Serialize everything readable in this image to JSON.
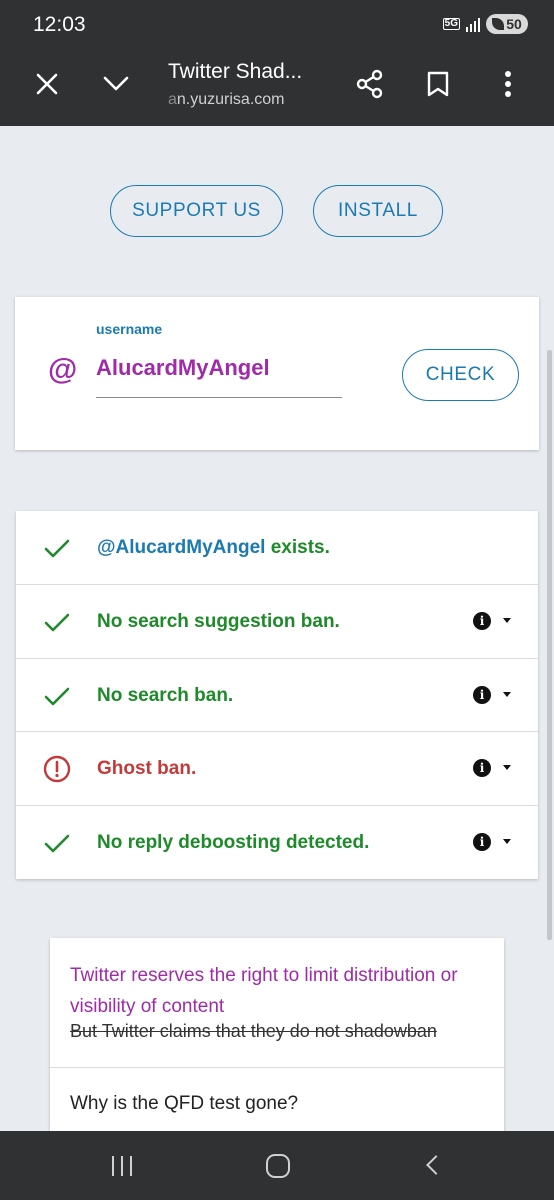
{
  "status": {
    "time": "12:03",
    "network": "5G",
    "battery": "50"
  },
  "browser": {
    "title": "Twitter Shad...",
    "url_prefix": "a",
    "url": "n.yuzurisa.com"
  },
  "buttons": {
    "support": "SUPPORT US",
    "install": "INSTALL"
  },
  "form": {
    "label": "username",
    "at": "@",
    "value": "AlucardMyAngel",
    "check": "CHECK"
  },
  "results": [
    {
      "handle": "@AlucardMyAngel",
      "text": " exists.",
      "status": "ok"
    },
    {
      "text": "No search suggestion ban.",
      "status": "ok"
    },
    {
      "text": "No search ban.",
      "status": "ok"
    },
    {
      "text": "Ghost ban.",
      "status": "bad"
    },
    {
      "text": "No reply deboosting detected.",
      "status": "ok"
    }
  ],
  "info_card": {
    "title": "Twitter reserves the right to limit distribution or visibility of content",
    "strike": "But Twitter claims that they do not shadowban",
    "question": "Why is the QFD test gone?"
  },
  "colors": {
    "accent_blue": "#1c7ab2",
    "purple": "#a02ba8",
    "ok_green": "#1e8a2a",
    "bad_red": "#c43a3a"
  }
}
